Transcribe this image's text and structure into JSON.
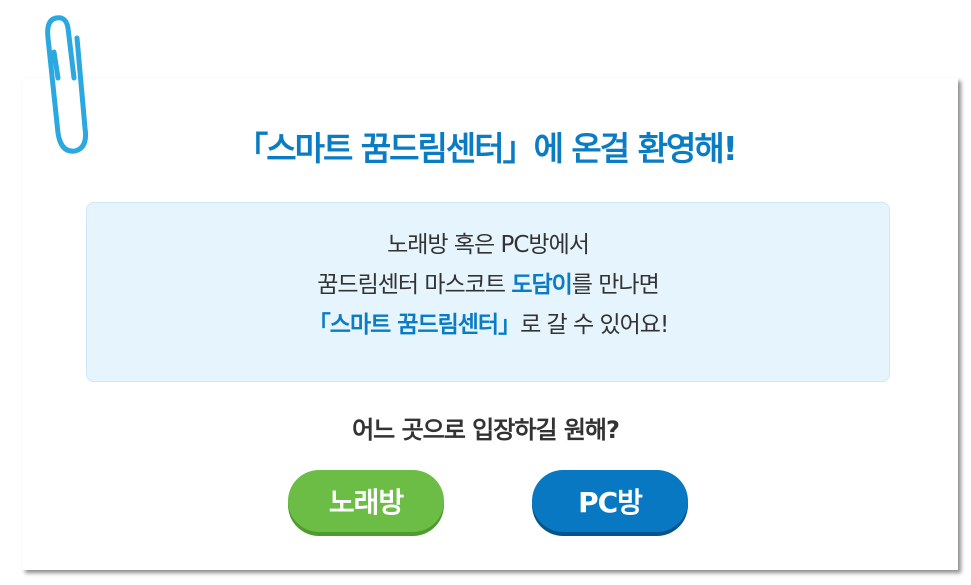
{
  "title": "「스마트 꿈드림센터」에 온걸 환영해!",
  "info": {
    "line1": "노래방 혹은 PC방에서",
    "line2_pre": "꿈드림센터 마스코트 ",
    "line2_hl": "도담이",
    "line2_post": "를 만나면",
    "line3_hl": "「스마트 꿈드림센터」",
    "line3_post": "로 갈 수 있어요!"
  },
  "question": "어느 곳으로 입장하길 원해?",
  "buttons": {
    "karaoke": "노래방",
    "pc": "PC방"
  },
  "colors": {
    "accent": "#0a7cc4",
    "green": "#6cbd45",
    "blue": "#0878c2",
    "clip": "#2aa8df"
  }
}
